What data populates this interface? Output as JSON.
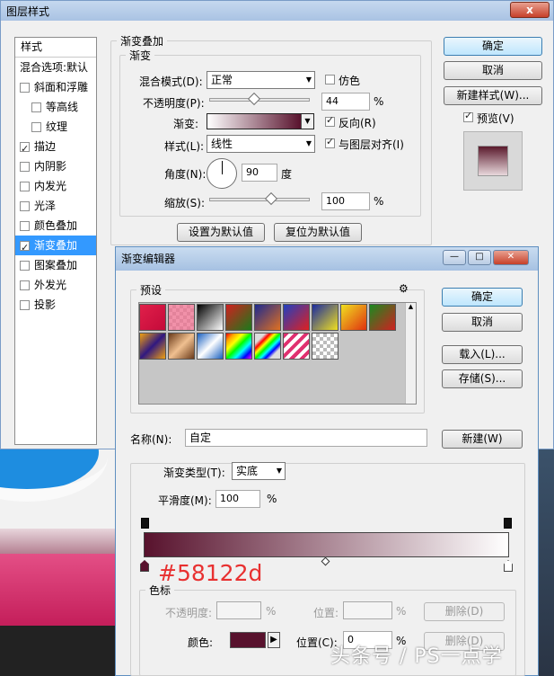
{
  "colors": {
    "gradient_start": "#58122d",
    "gradient_end": "#ffffff",
    "caption": "#e83030"
  },
  "layer_style": {
    "title": "图层样式",
    "close_glyph": "x",
    "styles_header": "样式",
    "blend_options": "混合选项:默认",
    "styles": [
      {
        "label": "斜面和浮雕",
        "checked": false
      },
      {
        "label": "等高线",
        "checked": false
      },
      {
        "label": "纹理",
        "checked": false
      },
      {
        "label": "描边",
        "checked": true
      },
      {
        "label": "内阴影",
        "checked": false
      },
      {
        "label": "内发光",
        "checked": false
      },
      {
        "label": "光泽",
        "checked": false
      },
      {
        "label": "颜色叠加",
        "checked": false
      },
      {
        "label": "渐变叠加",
        "checked": true
      },
      {
        "label": "图案叠加",
        "checked": false
      },
      {
        "label": "外发光",
        "checked": false
      },
      {
        "label": "投影",
        "checked": false
      }
    ],
    "section_title": "渐变叠加",
    "subsection_title": "渐变",
    "blend_mode_label": "混合模式(D):",
    "blend_mode_value": "正常",
    "dither_label": "仿色",
    "opacity_label": "不透明度(P):",
    "opacity_value": "44",
    "percent": "%",
    "gradient_label": "渐变:",
    "reverse_label": "反向(R)",
    "style_label": "样式(L):",
    "style_value": "线性",
    "align_label": "与图层对齐(I)",
    "angle_label": "角度(N):",
    "angle_value": "90",
    "degree": "度",
    "scale_label": "缩放(S):",
    "scale_value": "100",
    "set_default": "设置为默认值",
    "reset_default": "复位为默认值",
    "ok": "确定",
    "cancel": "取消",
    "new_style": "新建样式(W)...",
    "preview_label": "预览(V)"
  },
  "gradient_editor": {
    "title": "渐变编辑器",
    "presets_label": "预设",
    "gear_glyph": "⚙",
    "ok": "确定",
    "cancel": "取消",
    "load": "载入(L)...",
    "save": "存储(S)...",
    "name_label": "名称(N):",
    "name_value": "自定",
    "new_btn": "新建(W)",
    "type_label": "渐变类型(T):",
    "type_value": "实底",
    "smooth_label": "平滑度(M):",
    "smooth_value": "100",
    "percent": "%",
    "stops_group": "色标",
    "opacity_label": "不透明度:",
    "location_label": "位置:",
    "delete_label": "删除(D)",
    "color_label": "颜色:",
    "location_c_label": "位置(C):",
    "location_c_value": "0"
  },
  "annotation": "#58122d",
  "watermark": "头条号 / PS一点学"
}
